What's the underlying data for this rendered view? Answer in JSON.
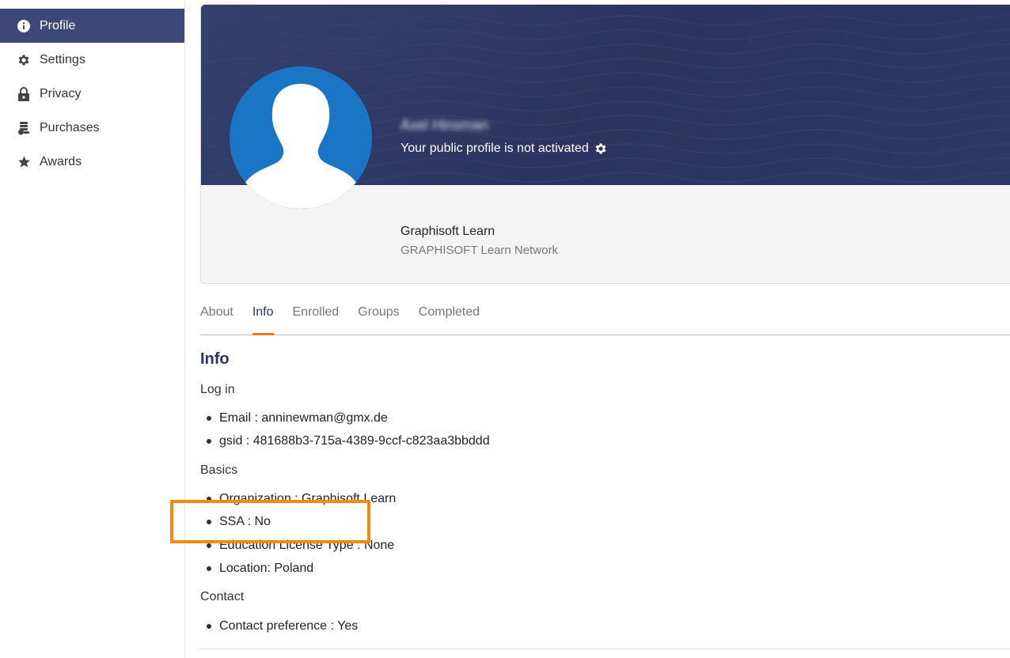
{
  "sidebar": {
    "items": [
      {
        "label": "Profile",
        "icon": "info-icon",
        "active": true
      },
      {
        "label": "Settings",
        "icon": "gear-icon",
        "active": false
      },
      {
        "label": "Privacy",
        "icon": "lock-icon",
        "active": false
      },
      {
        "label": "Purchases",
        "icon": "coins-icon",
        "active": false
      },
      {
        "label": "Awards",
        "icon": "star-icon",
        "active": false
      }
    ]
  },
  "profile": {
    "name": "Axel Hinsman",
    "public_status": "Your public profile is not activated",
    "organization": "Graphisoft Learn",
    "network": "GRAPHISOFT Learn Network"
  },
  "tabs": [
    {
      "label": "About",
      "active": false
    },
    {
      "label": "Info",
      "active": true
    },
    {
      "label": "Enrolled",
      "active": false
    },
    {
      "label": "Groups",
      "active": false
    },
    {
      "label": "Completed",
      "active": false
    }
  ],
  "info": {
    "title": "Info",
    "login": {
      "label": "Log in",
      "items": [
        "Email : anninewman@gmx.de",
        "gsid : 481688b3-715a-4389-9ccf-c823aa3bbddd"
      ]
    },
    "basics": {
      "label": "Basics",
      "items": [
        "Organization : Graphisoft Learn",
        "SSA : No",
        "Education License Type : None",
        "Location: Poland"
      ]
    },
    "contact": {
      "label": "Contact",
      "items": [
        "Contact preference : Yes"
      ]
    }
  },
  "colors": {
    "sidebar_active": "#3e4878",
    "banner": "#2b3560",
    "avatar": "#1a76c4",
    "accent": "#f07a1a",
    "highlight": "#f28a0f"
  }
}
